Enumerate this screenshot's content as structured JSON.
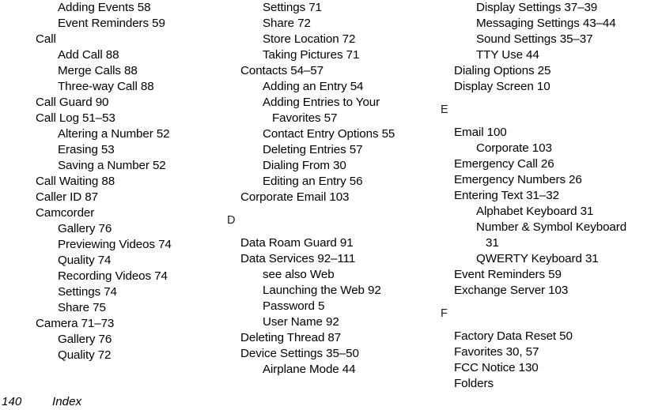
{
  "document": {
    "kind": "index-page",
    "footer": {
      "page_number": "140",
      "label": "Index"
    }
  },
  "columns": [
    {
      "id": "column-1",
      "lines": [
        {
          "level": 2,
          "text": "Adding Events 58"
        },
        {
          "level": 2,
          "text": "Event Reminders 59"
        },
        {
          "level": 1,
          "text": "Call"
        },
        {
          "level": 2,
          "text": "Add Call 88"
        },
        {
          "level": 2,
          "text": "Merge Calls 88"
        },
        {
          "level": 2,
          "text": "Three-way Call 88"
        },
        {
          "level": 1,
          "text": "Call Guard 90"
        },
        {
          "level": 1,
          "text": "Call Log 51–53"
        },
        {
          "level": 2,
          "text": "Altering a Number 52"
        },
        {
          "level": 2,
          "text": "Erasing 53"
        },
        {
          "level": 2,
          "text": "Saving a Number 52"
        },
        {
          "level": 1,
          "text": "Call Waiting 88"
        },
        {
          "level": 1,
          "text": "Caller ID 87"
        },
        {
          "level": 1,
          "text": "Camcorder"
        },
        {
          "level": 2,
          "text": "Gallery 76"
        },
        {
          "level": 2,
          "text": "Previewing Videos 74"
        },
        {
          "level": 2,
          "text": "Quality 74"
        },
        {
          "level": 2,
          "text": "Recording Videos 74"
        },
        {
          "level": 2,
          "text": "Settings 74"
        },
        {
          "level": 2,
          "text": "Share 75"
        },
        {
          "level": 1,
          "text": "Camera 71–73"
        },
        {
          "level": 2,
          "text": "Gallery 76"
        },
        {
          "level": 2,
          "text": "Quality 72"
        }
      ]
    },
    {
      "id": "column-2",
      "lines": [
        {
          "level": 2,
          "text": "Settings 71"
        },
        {
          "level": 2,
          "text": "Share 72"
        },
        {
          "level": 2,
          "text": "Store Location 72"
        },
        {
          "level": 2,
          "text": "Taking Pictures 71"
        },
        {
          "level": 1,
          "text": "Contacts 54–57"
        },
        {
          "level": 2,
          "text": "Adding an Entry 54"
        },
        {
          "level": 2,
          "text": "Adding Entries to Your"
        },
        {
          "level": 3,
          "text": "Favorites 57"
        },
        {
          "level": 2,
          "text": "Contact Entry Options 55"
        },
        {
          "level": 2,
          "text": "Deleting Entries 57"
        },
        {
          "level": 2,
          "text": "Dialing From 30"
        },
        {
          "level": 2,
          "text": "Editing an Entry 56"
        },
        {
          "level": 1,
          "text": "Corporate Email 103"
        },
        {
          "level": 0,
          "text": "D"
        },
        {
          "level": 1,
          "text": "Data Roam Guard 91"
        },
        {
          "level": 1,
          "text": "Data Services 92–111"
        },
        {
          "level": 2,
          "text": "see also Web"
        },
        {
          "level": 2,
          "text": "Launching the Web 92"
        },
        {
          "level": 2,
          "text": "Password 5"
        },
        {
          "level": 2,
          "text": "User Name 92"
        },
        {
          "level": 1,
          "text": "Deleting Thread 87"
        },
        {
          "level": 1,
          "text": "Device Settings 35–50"
        },
        {
          "level": 2,
          "text": "Airplane Mode 44"
        }
      ]
    },
    {
      "id": "column-3",
      "lines": [
        {
          "level": 2,
          "text": "Display Settings 37–39"
        },
        {
          "level": 2,
          "text": "Messaging Settings 43–44"
        },
        {
          "level": 2,
          "text": "Sound Settings 35–37"
        },
        {
          "level": 2,
          "text": "TTY Use 44"
        },
        {
          "level": 1,
          "text": "Dialing Options 25"
        },
        {
          "level": 1,
          "text": "Display Screen 10"
        },
        {
          "level": 0,
          "text": "E"
        },
        {
          "level": 1,
          "text": "Email 100"
        },
        {
          "level": 2,
          "text": "Corporate 103"
        },
        {
          "level": 1,
          "text": "Emergency Call 26"
        },
        {
          "level": 1,
          "text": "Emergency Numbers 26"
        },
        {
          "level": 1,
          "text": "Entering Text 31–32"
        },
        {
          "level": 2,
          "text": "Alphabet Keyboard 31"
        },
        {
          "level": 2,
          "text": "Number & Symbol Keyboard"
        },
        {
          "level": 3,
          "text": "31"
        },
        {
          "level": 2,
          "text": "QWERTY Keyboard 31"
        },
        {
          "level": 1,
          "text": "Event Reminders 59"
        },
        {
          "level": 1,
          "text": "Exchange Server 103"
        },
        {
          "level": 0,
          "text": "F"
        },
        {
          "level": 1,
          "text": "Factory Data Reset 50"
        },
        {
          "level": 1,
          "text": "Favorites 30, 57"
        },
        {
          "level": 1,
          "text": "FCC Notice 130"
        },
        {
          "level": 1,
          "text": "Folders"
        }
      ]
    }
  ]
}
